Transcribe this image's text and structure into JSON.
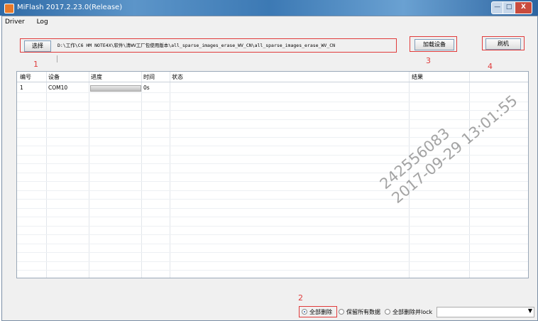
{
  "window": {
    "title": "MiFlash 2017.2.23.0(Release)",
    "minimize": "—",
    "maximize": "□",
    "close": "X"
  },
  "menu": [
    "Driver",
    "Log"
  ],
  "toolbar": {
    "select_label": "选择",
    "path": "D:\\工作\\C6 HM NOTE4X\\软件\\清WV工厂包使用版本\\all_sparse_images_erase_WV_CN\\all_sparse_images_erase_WV_CN",
    "load_label": "加载设备",
    "flash_label": "刷机"
  },
  "annotations": {
    "n1": "1",
    "n2": "2",
    "n3": "3",
    "n4": "4"
  },
  "table": {
    "headers": [
      "编号",
      "设备",
      "进度",
      "时间",
      "状态",
      "结果"
    ],
    "rows": [
      {
        "id": "1",
        "device": "COM10",
        "progress": 0.0,
        "time": "0s",
        "status": "",
        "result": ""
      }
    ]
  },
  "watermark": {
    "line1": "242556083",
    "line2": "2017-09-29 13:01:55"
  },
  "footer": {
    "options": [
      "全部删除",
      "保留所有数据",
      "全部删除并lock"
    ],
    "selected": "全部删除",
    "combo_value": "",
    "combo_arrow": "▼"
  },
  "colors": {
    "annotation_red": "#e03b3b",
    "titlebar": "#3c79b4"
  }
}
